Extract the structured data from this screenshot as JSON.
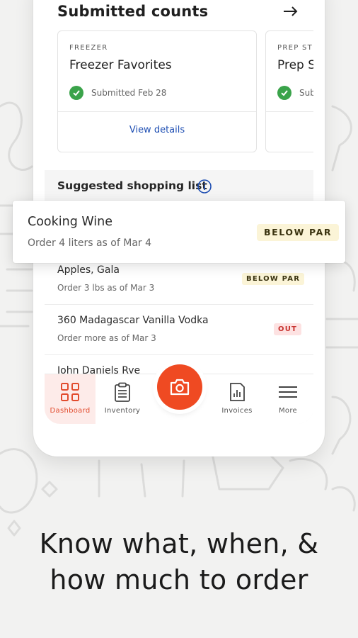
{
  "submitted_counts": {
    "title": "Submitted counts",
    "cards": [
      {
        "category": "FREEZER",
        "name": "Freezer Favorites",
        "status": "Submitted Feb 28",
        "link": "View details"
      },
      {
        "category": "PREP ST",
        "name": "Prep S",
        "status": "Sub",
        "link": ""
      }
    ]
  },
  "shopping_list": {
    "title": "Suggested shopping list",
    "items": [
      {
        "name": "Cooking Wine",
        "sub": "Order 4 liters as of Mar 4",
        "badge": "BELOW PAR"
      },
      {
        "name": "Apples, Gala",
        "sub": "Order 3 lbs as of Mar 3",
        "badge": "BELOW PAR"
      },
      {
        "name": "360 Madagascar Vanilla Vodka",
        "sub": "Order more as of Mar 3",
        "badge": "OUT"
      },
      {
        "name": "John Daniels Rye",
        "sub": "",
        "badge": ""
      }
    ]
  },
  "nav": {
    "items": [
      {
        "label": "Dashboard",
        "icon": "grid-icon",
        "active": true
      },
      {
        "label": "Inventory",
        "icon": "clipboard-icon",
        "active": false
      },
      {
        "label": "",
        "icon": "camera-icon",
        "active": false
      },
      {
        "label": "Invoices",
        "icon": "invoice-icon",
        "active": false
      },
      {
        "label": "More",
        "icon": "menu-icon",
        "active": false
      }
    ]
  },
  "tagline": {
    "line1": "Know what, when, &",
    "line2": "how much to order"
  },
  "colors": {
    "accent": "#ef4a22",
    "check": "#3aa34a",
    "link": "#1f4fb3",
    "below_par_bg": "#fbf4d7",
    "out_bg": "#fde2e2",
    "out_text": "#c7322f"
  }
}
